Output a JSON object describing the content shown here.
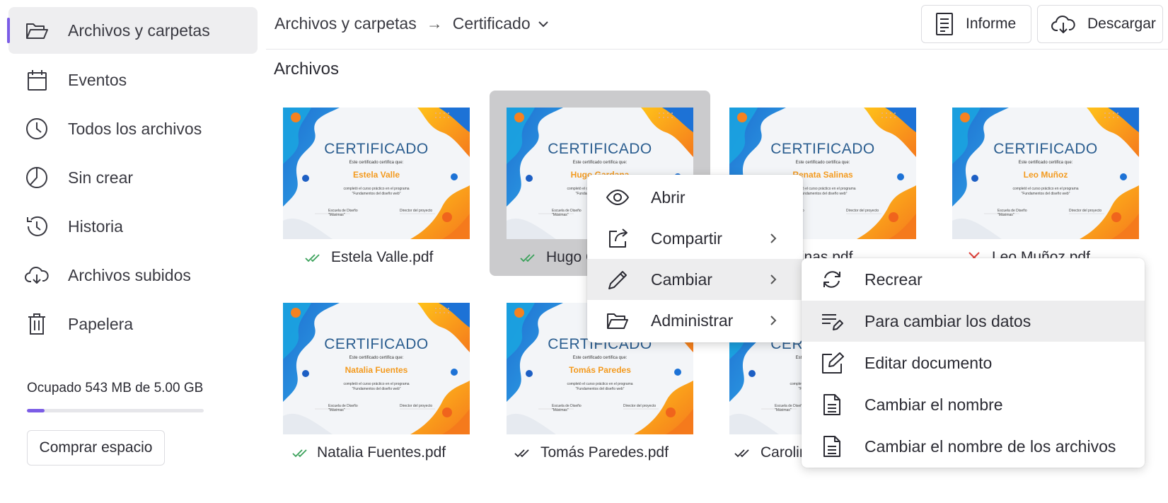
{
  "sidebar": {
    "items": [
      {
        "label": "Archivos y carpetas",
        "icon": "folder-open-icon",
        "active": true
      },
      {
        "label": "Eventos",
        "icon": "calendar-icon"
      },
      {
        "label": "Todos los archivos",
        "icon": "clock-icon"
      },
      {
        "label": "Sin crear",
        "icon": "pie-chart-icon"
      },
      {
        "label": "Historia",
        "icon": "history-icon"
      },
      {
        "label": "Archivos subidos",
        "icon": "cloud-upload-icon"
      },
      {
        "label": "Papelera",
        "icon": "trash-icon"
      }
    ],
    "storage_text": "Ocupado 543 MB de 5.00 GB",
    "storage_used_fraction": 0.1,
    "buy_button": "Comprar espacio"
  },
  "header": {
    "breadcrumb_root": "Archivos y carpetas",
    "breadcrumb_separator": "→",
    "breadcrumb_current": "Certificado",
    "report_button": "Informe",
    "download_button": "Descargar"
  },
  "section_title": "Archivos",
  "files": [
    {
      "name": "Estela Valle.pdf",
      "person": "Estela Valle",
      "status": "check-green"
    },
    {
      "name": "Hugo C",
      "person": "Hugo Gardana",
      "status": "check-green",
      "selected": true
    },
    {
      "name": "a Salinas.pdf",
      "person": "Renata Salinas",
      "status": "none"
    },
    {
      "name": "Leo Muñoz.pdf",
      "person": "Leo Muñoz",
      "status": "error-red"
    },
    {
      "name": "Natalia Fuentes.pdf",
      "person": "Natalia Fuentes",
      "status": "check-green"
    },
    {
      "name": "Tomás Paredes.pdf",
      "person": "Tomás Paredes",
      "status": "check-dark"
    },
    {
      "name": "Carolin",
      "person": "Ca",
      "status": "check-dark"
    }
  ],
  "certificate": {
    "title": "CERTIFICADO",
    "subtitle": "Este certificado certifica que:",
    "line1": "completó el curso práctico en el programa",
    "line2": "\"Fundamentos del diseño web\"",
    "sig_left_1": "Escuela de Diseño",
    "sig_left_2": "\"Máximas\"",
    "sig_right": "Director del proyecto"
  },
  "context_menu": {
    "items": [
      {
        "label": "Abrir",
        "icon": "eye-icon",
        "submenu": false
      },
      {
        "label": "Compartir",
        "icon": "share-icon",
        "submenu": true
      },
      {
        "label": "Cambiar",
        "icon": "pencil-icon",
        "submenu": true,
        "hover": true
      },
      {
        "label": "Administrar",
        "icon": "folder-open-icon",
        "submenu": true
      }
    ]
  },
  "submenu": {
    "items": [
      {
        "label": "Recrear",
        "icon": "refresh-icon"
      },
      {
        "label": "Para cambiar los datos",
        "icon": "list-edit-icon",
        "hover": true
      },
      {
        "label": "Editar documento",
        "icon": "edit-square-icon"
      },
      {
        "label": "Cambiar el nombre",
        "icon": "document-icon"
      },
      {
        "label": "Cambiar el nombre de los archivos",
        "icon": "document-icon"
      }
    ]
  },
  "colors": {
    "accent": "#7b5ce6",
    "check_green": "#3aa15a",
    "error_red": "#e0413a",
    "cert_blue": "#2a5d8f",
    "cert_orange": "#f39a1e"
  }
}
